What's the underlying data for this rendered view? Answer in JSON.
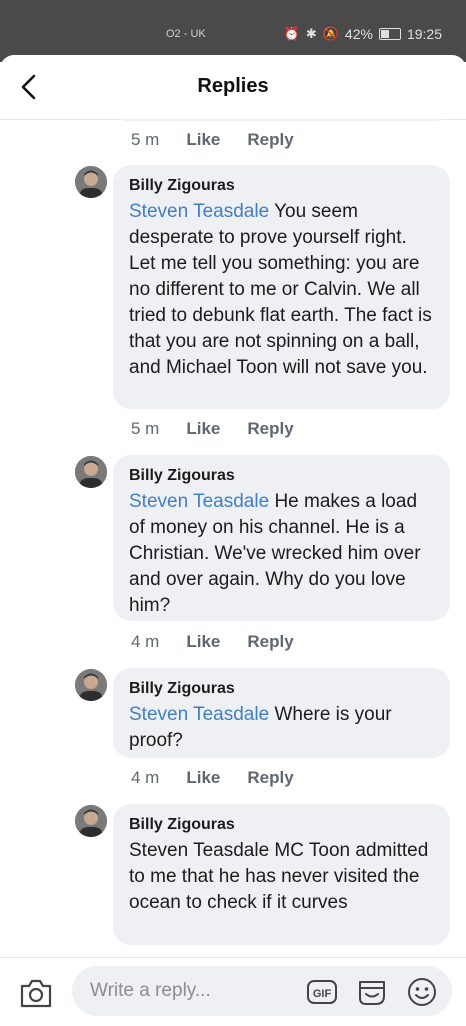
{
  "status_bar": {
    "carrier": "O2 - UK",
    "battery_percent": "42%",
    "time": "19:25"
  },
  "header": {
    "title": "Replies"
  },
  "top_reply": {
    "time": "5 m",
    "like": "Like",
    "reply": "Reply"
  },
  "comments": [
    {
      "author": "Billy Zigouras",
      "mention": "Steven Teasdale",
      "text": "You seem desperate to prove yourself right. Let me tell you something: you are no different to me or Calvin. We all tried to debunk flat earth. The fact is that you are not spinning on a ball, and Michael Toon will not save you.",
      "time": "5 m",
      "like": "Like",
      "reply": "Reply"
    },
    {
      "author": "Billy Zigouras",
      "mention": "Steven Teasdale",
      "text": "He makes a load of money on his channel. He is a Christian. We've wrecked him over and over again. Why do you love him?",
      "time": "4 m",
      "like": "Like",
      "reply": "Reply"
    },
    {
      "author": "Billy Zigouras",
      "mention": "Steven Teasdale",
      "text": "Where is your proof?",
      "time": "4 m",
      "like": "Like",
      "reply": "Reply"
    },
    {
      "author": "Billy Zigouras",
      "mention": "",
      "text": "Steven Teasdale MC Toon admitted to me that he has never visited the ocean to check if it curves"
    }
  ],
  "composer": {
    "placeholder": "Write a reply...",
    "gif_label": "GIF"
  },
  "icons": {
    "back": "back-arrow-icon",
    "camera": "camera-icon",
    "gif": "gif-icon",
    "sticker": "sticker-icon",
    "emoji": "emoji-icon"
  },
  "colors": {
    "mention": "#3f7fc8",
    "bubble": "#eef0f3",
    "status_bar": "#4a4a4a"
  }
}
